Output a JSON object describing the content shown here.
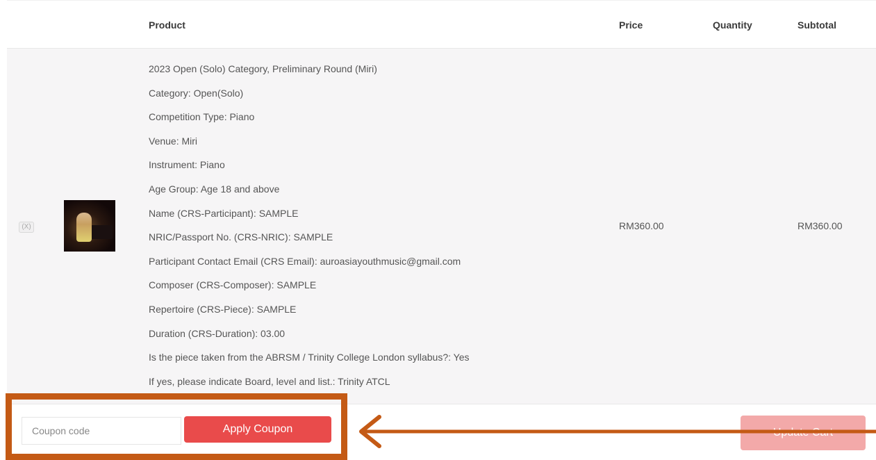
{
  "table": {
    "headers": {
      "product": "Product",
      "price": "Price",
      "quantity": "Quantity",
      "subtotal": "Subtotal"
    },
    "item": {
      "remove_label": "(X)",
      "details": [
        "2023 Open (Solo) Category, Preliminary Round (Miri)",
        "Category: Open(Solo)",
        "Competition Type: Piano",
        "Venue: Miri",
        "Instrument: Piano",
        "Age Group: Age 18 and above",
        "Name (CRS-Participant): SAMPLE",
        "NRIC/Passport No. (CRS-NRIC): SAMPLE",
        "Participant Contact Email (CRS Email): auroasiayouthmusic@gmail.com",
        "Composer (CRS-Composer): SAMPLE",
        "Repertoire (CRS-Piece): SAMPLE",
        "Duration (CRS-Duration): 03.00",
        "Is the piece taken from the ABRSM / Trinity College London syllabus?: Yes",
        "If yes, please indicate Board, level and list.: Trinity ATCL"
      ],
      "price": "RM360.00",
      "subtotal": "RM360.00"
    }
  },
  "actions": {
    "coupon_placeholder": "Coupon code",
    "apply_coupon_label": "Apply Coupon",
    "update_cart_label": "Update Cart"
  },
  "annotation": {
    "highlight_color": "#c45a15"
  },
  "colors": {
    "accent": "#e94b4b",
    "accent_disabled": "#f3a9a9",
    "row_bg": "#f6f5f6"
  }
}
